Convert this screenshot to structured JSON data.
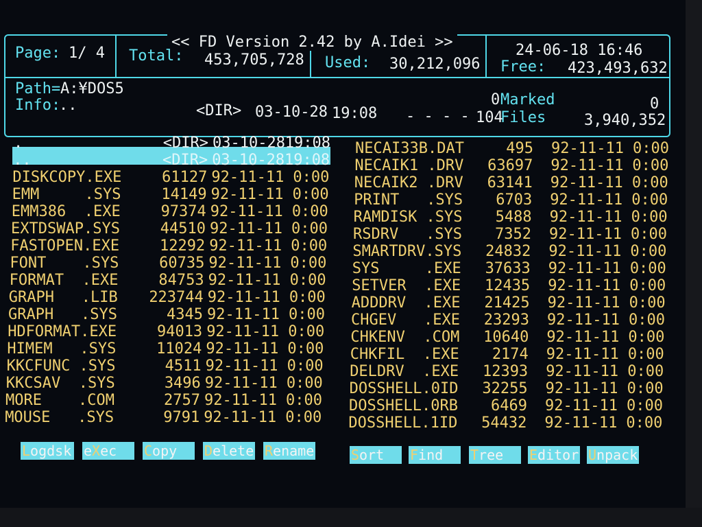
{
  "header": {
    "title": "<< FD Version 2.42 by A.Idei >>",
    "datetime": "24-06-18 16:46",
    "page_label": "Page:",
    "page_value": "1/ 4",
    "total_label": "Total:",
    "total_value": "453,705,728",
    "used_label": "Used:",
    "used_value": "30,212,096",
    "free_label": "Free:",
    "free_value": "423,493,632",
    "path_label": "Path=",
    "path_value": "A:¥DOS5",
    "info_label": "Info:",
    "info_value": "..",
    "info_dir": "<DIR>",
    "info_date": "03-10-28",
    "info_time": "19:08",
    "info_dashes": "- - - -",
    "marked_count": "0",
    "marked_label": "Marked",
    "marked_size": "0",
    "files_count": "104",
    "files_label": "Files",
    "files_size": "3,940,352"
  },
  "left_files": [
    {
      "name": ".",
      "size": "<DIR>",
      "date": "03-10-28",
      "time": "19:08"
    },
    {
      "name": "..",
      "size": "<DIR>",
      "date": "03-10-28",
      "time": "19:08"
    },
    {
      "name": "DISKCOPY.EXE",
      "size": "61127",
      "date": "92-11-11",
      "time": "0:00"
    },
    {
      "name": "EMM     .SYS",
      "size": "14149",
      "date": "92-11-11",
      "time": "0:00"
    },
    {
      "name": "EMM386  .EXE",
      "size": "97374",
      "date": "92-11-11",
      "time": "0:00"
    },
    {
      "name": "EXTDSWAP.SYS",
      "size": "44510",
      "date": "92-11-11",
      "time": "0:00"
    },
    {
      "name": "FASTOPEN.EXE",
      "size": "12292",
      "date": "92-11-11",
      "time": "0:00"
    },
    {
      "name": "FONT    .SYS",
      "size": "60735",
      "date": "92-11-11",
      "time": "0:00"
    },
    {
      "name": "FORMAT  .EXE",
      "size": "84753",
      "date": "92-11-11",
      "time": "0:00"
    },
    {
      "name": "GRAPH   .LIB",
      "size": "223744",
      "date": "92-11-11",
      "time": "0:00"
    },
    {
      "name": "GRAPH   .SYS",
      "size": "4345",
      "date": "92-11-11",
      "time": "0:00"
    },
    {
      "name": "HDFORMAT.EXE",
      "size": "94013",
      "date": "92-11-11",
      "time": "0:00"
    },
    {
      "name": "HIMEM   .SYS",
      "size": "11024",
      "date": "92-11-11",
      "time": "0:00"
    },
    {
      "name": "KKCFUNC .SYS",
      "size": "4511",
      "date": "92-11-11",
      "time": "0:00"
    },
    {
      "name": "KKCSAV  .SYS",
      "size": "3496",
      "date": "92-11-11",
      "time": "0:00"
    },
    {
      "name": "MORE    .COM",
      "size": "2757",
      "date": "92-11-11",
      "time": "0:00"
    },
    {
      "name": "MOUSE   .SYS",
      "size": "9791",
      "date": "92-11-11",
      "time": "0:00"
    }
  ],
  "right_files": [
    {
      "name": "NECAI33B.DAT",
      "size": "495",
      "date": "92-11-11",
      "time": "0:00"
    },
    {
      "name": "NECAIK1 .DRV",
      "size": "63697",
      "date": "92-11-11",
      "time": "0:00"
    },
    {
      "name": "NECAIK2 .DRV",
      "size": "63141",
      "date": "92-11-11",
      "time": "0:00"
    },
    {
      "name": "PRINT   .SYS",
      "size": "6703",
      "date": "92-11-11",
      "time": "0:00"
    },
    {
      "name": "RAMDISK .SYS",
      "size": "5488",
      "date": "92-11-11",
      "time": "0:00"
    },
    {
      "name": "RSDRV   .SYS",
      "size": "7352",
      "date": "92-11-11",
      "time": "0:00"
    },
    {
      "name": "SMARTDRV.SYS",
      "size": "24832",
      "date": "92-11-11",
      "time": "0:00"
    },
    {
      "name": "SYS     .EXE",
      "size": "37633",
      "date": "92-11-11",
      "time": "0:00"
    },
    {
      "name": "SETVER  .EXE",
      "size": "12435",
      "date": "92-11-11",
      "time": "0:00"
    },
    {
      "name": "ADDDRV  .EXE",
      "size": "21425",
      "date": "92-11-11",
      "time": "0:00"
    },
    {
      "name": "CHGEV   .EXE",
      "size": "23293",
      "date": "92-11-11",
      "time": "0:00"
    },
    {
      "name": "CHKENV  .COM",
      "size": "10640",
      "date": "92-11-11",
      "time": "0:00"
    },
    {
      "name": "CHKFIL  .EXE",
      "size": "2174",
      "date": "92-11-11",
      "time": "0:00"
    },
    {
      "name": "DELDRV  .EXE",
      "size": "12393",
      "date": "92-11-11",
      "time": "0:00"
    },
    {
      "name": "DOSSHELL.0ID",
      "size": "32255",
      "date": "92-11-11",
      "time": "0:00"
    },
    {
      "name": "DOSSHELL.0RB",
      "size": "6469",
      "date": "92-11-11",
      "time": "0:00"
    },
    {
      "name": "DOSSHELL.1ID",
      "size": "54432",
      "date": "92-11-11",
      "time": "0:00"
    }
  ],
  "function_keys": [
    {
      "hotkey": "L",
      "rest": "ogdsk"
    },
    {
      "hotkey": "",
      "pre": "e",
      "mid": "X",
      "rest": "ec"
    },
    {
      "hotkey": "C",
      "rest": "opy"
    },
    {
      "hotkey": "D",
      "rest": "elete"
    },
    {
      "hotkey": "R",
      "rest": "ename"
    },
    {
      "hotkey": "S",
      "rest": "ort"
    },
    {
      "hotkey": "F",
      "rest": "ind"
    },
    {
      "hotkey": "T",
      "rest": "ree"
    },
    {
      "hotkey": "E",
      "rest": "ditor"
    },
    {
      "hotkey": "U",
      "rest": "npack"
    }
  ]
}
